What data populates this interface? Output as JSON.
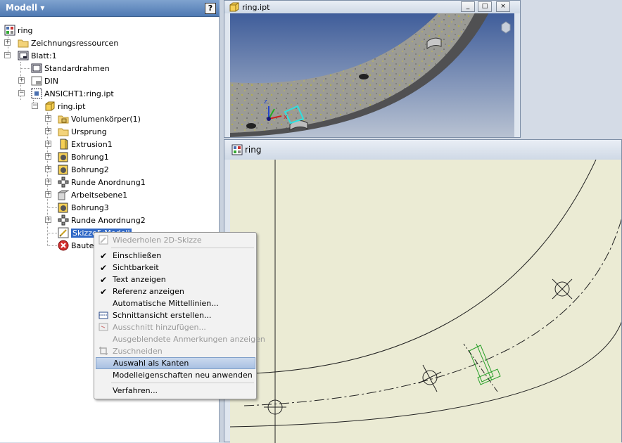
{
  "browser": {
    "title": "Modell",
    "help": "?",
    "tree": [
      {
        "label": "ring",
        "icon": "drawing-icon"
      },
      {
        "label": "Zeichnungsressourcen",
        "icon": "folder-icon"
      },
      {
        "label": "Blatt:1",
        "icon": "sheet-icon"
      },
      {
        "label": "Standardrahmen",
        "icon": "frame-icon"
      },
      {
        "label": "DIN",
        "icon": "title-block-icon"
      },
      {
        "label": "ANSICHT1:ring.ipt",
        "icon": "view-icon"
      },
      {
        "label": "ring.ipt",
        "icon": "part-icon"
      },
      {
        "label": "Volumenkörper(1)",
        "icon": "solid-bodies-icon"
      },
      {
        "label": "Ursprung",
        "icon": "folder-icon"
      },
      {
        "label": "Extrusion1",
        "icon": "extrusion-icon"
      },
      {
        "label": "Bohrung1",
        "icon": "hole-icon"
      },
      {
        "label": "Bohrung2",
        "icon": "hole-icon"
      },
      {
        "label": "Runde Anordnung1",
        "icon": "circular-pattern-icon"
      },
      {
        "label": "Arbeitsebene1",
        "icon": "work-plane-icon"
      },
      {
        "label": "Bohrung3",
        "icon": "hole-icon"
      },
      {
        "label": "Runde Anordnung2",
        "icon": "circular-pattern-icon"
      },
      {
        "label": "Skizze5:Modell",
        "icon": "sketch-icon"
      },
      {
        "label": "Bauteil",
        "icon": "error-icon"
      }
    ]
  },
  "window_3d": {
    "title": "ring.ipt",
    "buttons": [
      "_",
      "□",
      "×"
    ]
  },
  "window_drawing": {
    "title": "ring"
  },
  "context_menu": {
    "items": [
      {
        "label": "Wiederholen 2D-Skizze",
        "enabled": false,
        "icon": "sketch-icon"
      },
      {
        "label": "Einschließen",
        "checked": true
      },
      {
        "label": "Sichtbarkeit",
        "checked": true
      },
      {
        "label": "Text anzeigen",
        "checked": true
      },
      {
        "label": "Referenz anzeigen",
        "checked": true
      },
      {
        "label": "Automatische Mittellinien..."
      },
      {
        "label": "Schnittansicht erstellen...",
        "icon": "section-view-icon"
      },
      {
        "label": "Ausschnitt hinzufügen...",
        "enabled": false,
        "icon": "breakout-icon"
      },
      {
        "label": "Ausgeblendete Anmerkungen anzeigen",
        "enabled": false
      },
      {
        "label": "Zuschneiden",
        "enabled": false,
        "icon": "crop-icon"
      },
      {
        "label": "Auswahl als Kanten",
        "highlighted": true
      },
      {
        "label": "Modelleigenschaften neu anwenden"
      },
      {
        "label": "Verfahren..."
      }
    ]
  },
  "colors": {
    "header": "#5a84bd",
    "selection": "#3169c6",
    "drawing_bg": "#ebebd4",
    "menu_highlight": "#b9cde8"
  }
}
